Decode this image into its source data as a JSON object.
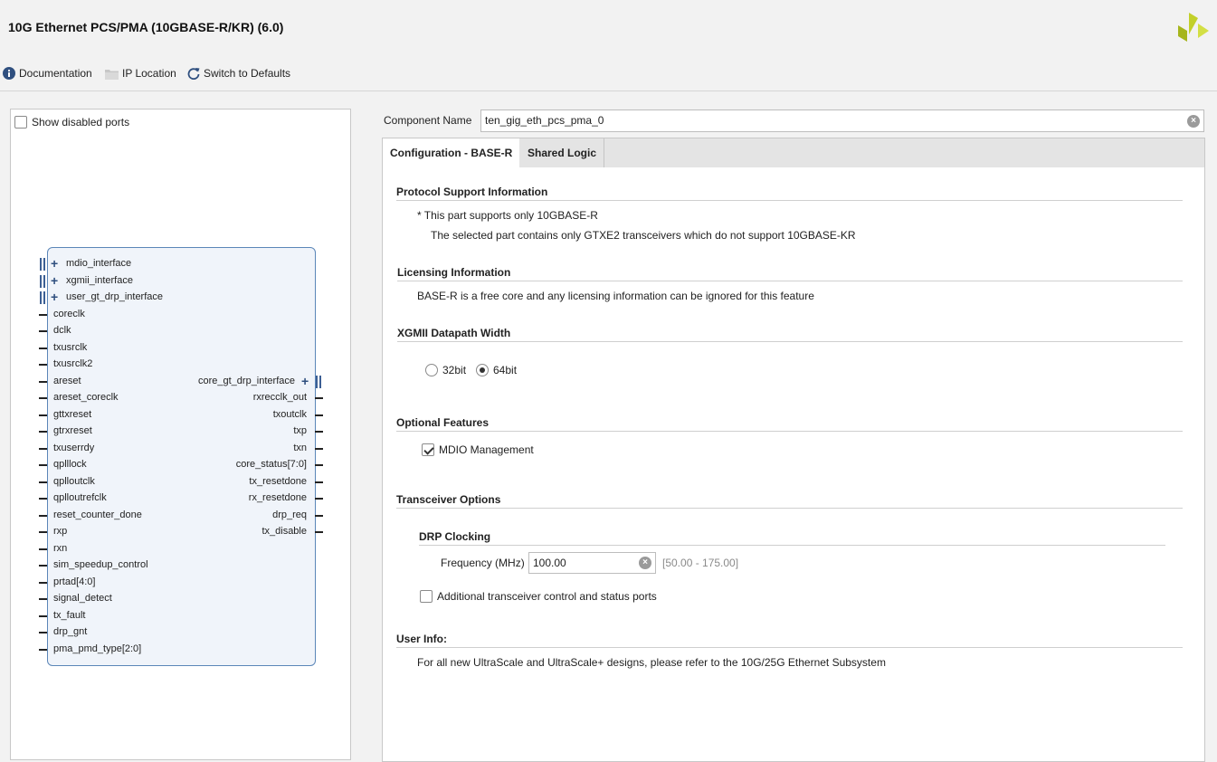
{
  "window": {
    "title": "10G Ethernet PCS/PMA (10GBASE-R/KR) (6.0)"
  },
  "toolbar": {
    "documentation": "Documentation",
    "ip_location": "IP Location",
    "switch_defaults": "Switch to Defaults"
  },
  "schematic": {
    "show_disabled_label": "Show disabled ports",
    "show_disabled_checked": false,
    "left_bus_ports": [
      "mdio_interface",
      "xgmii_interface",
      "user_gt_drp_interface"
    ],
    "left_ports": [
      "coreclk",
      "dclk",
      "txusrclk",
      "txusrclk2",
      "areset",
      "areset_coreclk",
      "gttxreset",
      "gtrxreset",
      "txuserrdy",
      "qplllock",
      "qplloutclk",
      "qplloutrefclk",
      "reset_counter_done",
      "rxp",
      "rxn",
      "sim_speedup_control",
      "prtad[4:0]",
      "signal_detect",
      "tx_fault",
      "drp_gnt",
      "pma_pmd_type[2:0]"
    ],
    "right_bus_port": "core_gt_drp_interface",
    "right_ports": [
      "rxrecclk_out",
      "txoutclk",
      "txp",
      "txn",
      "core_status[7:0]",
      "tx_resetdone",
      "rx_resetdone",
      "drp_req",
      "tx_disable"
    ]
  },
  "config": {
    "component_name_label": "Component Name",
    "component_name_value": "ten_gig_eth_pcs_pma_0",
    "tabs": [
      "Configuration - BASE-R",
      "Shared Logic"
    ],
    "active_tab": "Configuration - BASE-R",
    "protocol": {
      "title": "Protocol Support Information",
      "line1": "* This part supports only 10GBASE-R",
      "line2": "The selected part contains only GTXE2 transceivers which do not support 10GBASE-KR"
    },
    "licensing": {
      "title": "Licensing Information",
      "text": "BASE-R is a free core and any licensing information can be ignored for this feature"
    },
    "xgmii": {
      "title": "XGMII Datapath Width",
      "options": [
        "32bit",
        "64bit"
      ],
      "selected": "64bit"
    },
    "optional": {
      "title": "Optional Features",
      "mdio_label": "MDIO Management",
      "mdio_checked": true
    },
    "transceiver": {
      "title": "Transceiver Options",
      "drp_title": "DRP Clocking",
      "freq_label": "Frequency (MHz)",
      "freq_value": "100.00",
      "freq_range": "[50.00 - 175.00]",
      "additional_label": "Additional transceiver control and status ports",
      "additional_checked": false
    },
    "userinfo": {
      "title": "User Info:",
      "text": "For all new UltraScale and UltraScale+ designs, please refer to the 10G/25G Ethernet Subsystem"
    }
  },
  "colors": {
    "accent": "#5b86b8",
    "logo": "#b5c31f",
    "background": "#f2f2f2"
  }
}
